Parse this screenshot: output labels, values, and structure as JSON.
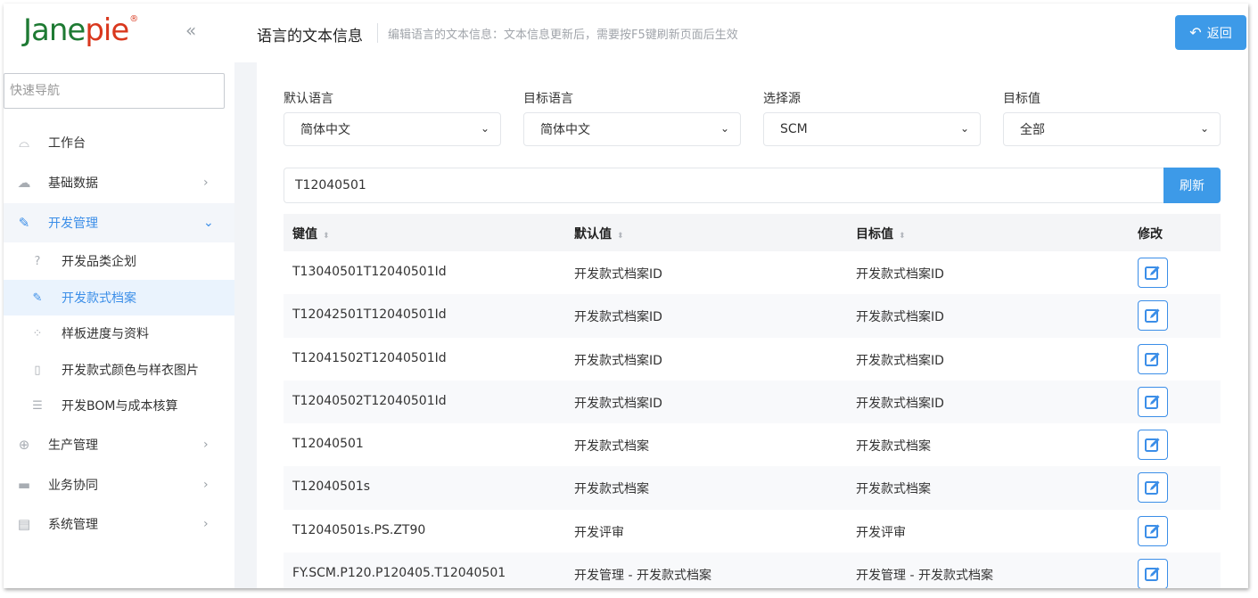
{
  "brand": {
    "name_part1": "Jane",
    "name_part2": "pie",
    "registered": "®",
    "collapse_glyph": "«"
  },
  "sidebar": {
    "search_placeholder": "快速导航",
    "menu": [
      {
        "label": "工作台",
        "icon": "chart-icon",
        "glyph": "⌓",
        "has_arrow": false
      },
      {
        "label": "基础数据",
        "icon": "cloud-icon",
        "glyph": "☁",
        "has_arrow": true,
        "arrow": "›"
      },
      {
        "label": "开发管理",
        "icon": "design-icon",
        "glyph": "✎",
        "has_arrow": true,
        "arrow": "⌄",
        "open": true
      },
      {
        "label": "生产管理",
        "icon": "plus-circle-icon",
        "glyph": "⊕",
        "has_arrow": true,
        "arrow": "›"
      },
      {
        "label": "业务协同",
        "icon": "chat-icon",
        "glyph": "▬",
        "has_arrow": true,
        "arrow": "›"
      },
      {
        "label": "系统管理",
        "icon": "settings-panel-icon",
        "glyph": "▤",
        "has_arrow": true,
        "arrow": "›"
      }
    ],
    "submenu": [
      {
        "label": "开发品类企划",
        "icon": "question-icon",
        "glyph": "?"
      },
      {
        "label": "开发款式档案",
        "icon": "design-icon",
        "glyph": "✎",
        "active": true
      },
      {
        "label": "样板进度与资料",
        "icon": "grid-icon",
        "glyph": "⁘"
      },
      {
        "label": "开发款式颜色与样衣图片",
        "icon": "document-icon",
        "glyph": "▯"
      },
      {
        "label": "开发BOM与成本核算",
        "icon": "list-icon",
        "glyph": "☰"
      }
    ]
  },
  "header": {
    "title": "语言的文本信息",
    "subtitle": "编辑语言的文本信息：文本信息更新后，需要按F5键刷新页面后生效",
    "back_label": "返回",
    "back_glyph": "↶"
  },
  "filters": [
    {
      "label": "默认语言",
      "value": "简体中文"
    },
    {
      "label": "目标语言",
      "value": "简体中文"
    },
    {
      "label": "选择源",
      "value": "SCM"
    },
    {
      "label": "目标值",
      "value": "全部"
    }
  ],
  "search": {
    "value": "T12040501",
    "refresh_label": "刷新"
  },
  "table": {
    "headers": [
      "键值",
      "默认值",
      "目标值",
      "修改"
    ],
    "sort_glyph": "⬍",
    "rows": [
      {
        "key": "T13040501T12040501Id",
        "default": "开发款式档案ID",
        "target": "开发款式档案ID"
      },
      {
        "key": "T12042501T12040501Id",
        "default": "开发款式档案ID",
        "target": "开发款式档案ID"
      },
      {
        "key": "T12041502T12040501Id",
        "default": "开发款式档案ID",
        "target": "开发款式档案ID"
      },
      {
        "key": "T12040502T12040501Id",
        "default": "开发款式档案ID",
        "target": "开发款式档案ID"
      },
      {
        "key": "T12040501",
        "default": "开发款式档案",
        "target": "开发款式档案"
      },
      {
        "key": "T12040501s",
        "default": "开发款式档案",
        "target": "开发款式档案"
      },
      {
        "key": "T12040501s.PS.ZT90",
        "default": "开发评审",
        "target": "开发评审"
      },
      {
        "key": "FY.SCM.P120.P120405.T12040501",
        "default": "开发管理 - 开发款式档案",
        "target": "开发管理 - 开发款式档案"
      }
    ]
  },
  "colors": {
    "accent": "#3d9ae8",
    "brand_green": "#1e7a33",
    "brand_red": "#d9381e"
  }
}
